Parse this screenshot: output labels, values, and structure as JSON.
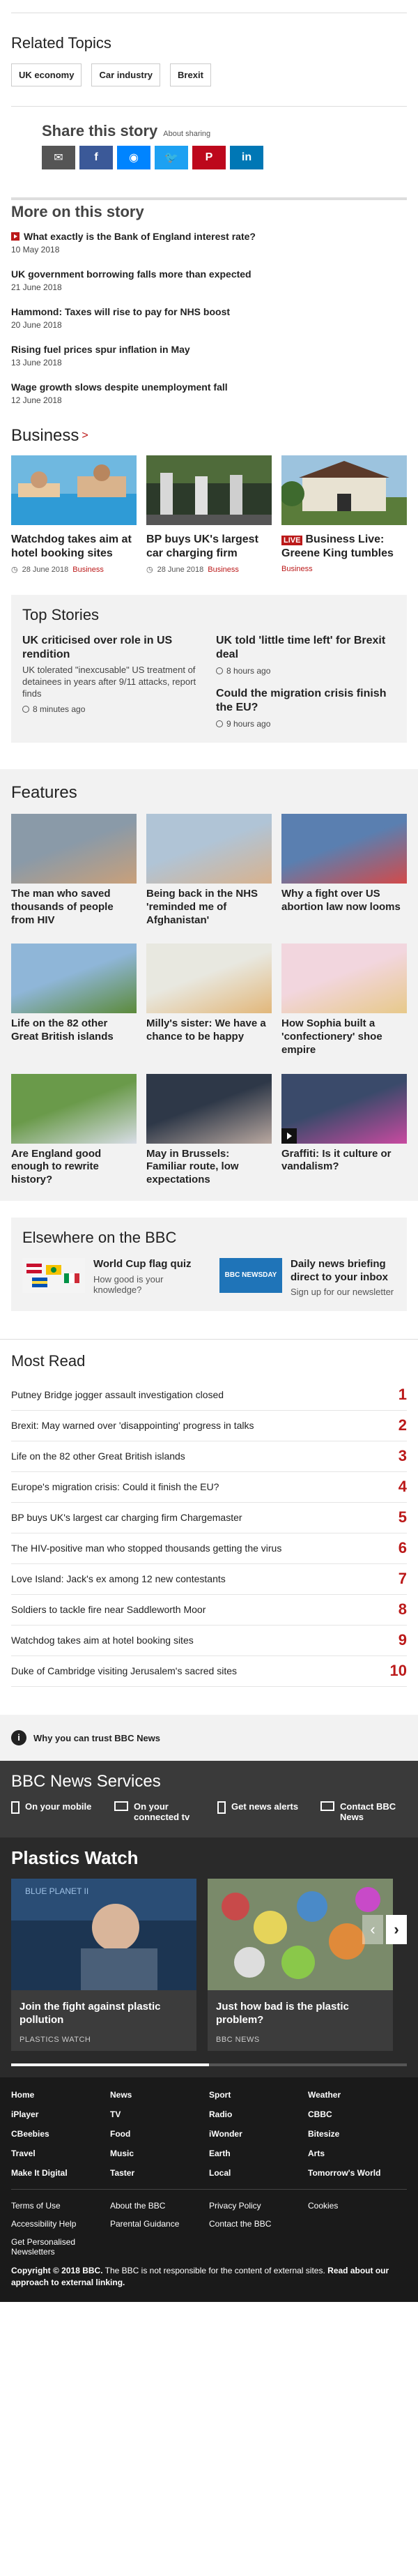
{
  "related": {
    "title": "Related Topics",
    "tags": [
      "UK economy",
      "Car industry",
      "Brexit"
    ]
  },
  "share": {
    "title": "Share this story",
    "about": "About sharing",
    "buttons": [
      {
        "name": "email-share-button",
        "glyph": "✉",
        "color": "#555555"
      },
      {
        "name": "facebook-share-button",
        "glyph": "f",
        "color": "#3b5998"
      },
      {
        "name": "messenger-share-button",
        "glyph": "◉",
        "color": "#0084ff"
      },
      {
        "name": "twitter-share-button",
        "glyph": "🐦",
        "color": "#1da1f2"
      },
      {
        "name": "pinterest-share-button",
        "glyph": "P",
        "color": "#bd081c"
      },
      {
        "name": "linkedin-share-button",
        "glyph": "in",
        "color": "#0077b5"
      }
    ]
  },
  "more": {
    "title": "More on this story",
    "stories": [
      {
        "title": "What exactly is the Bank of England interest rate?",
        "date": "10 May 2018",
        "video": true
      },
      {
        "title": "UK government borrowing falls more than expected",
        "date": "21 June 2018",
        "video": false
      },
      {
        "title": "Hammond: Taxes will rise to pay for NHS boost",
        "date": "20 June 2018",
        "video": false
      },
      {
        "title": "Rising fuel prices spur inflation in May",
        "date": "13 June 2018",
        "video": false
      },
      {
        "title": "Wage growth slows despite unemployment fall",
        "date": "12 June 2018",
        "video": false
      }
    ]
  },
  "business": {
    "title": "Business",
    "cards": [
      {
        "title": "Watchdog takes aim at hotel booking sites",
        "date": "28 June 2018",
        "source": "Business",
        "live": ""
      },
      {
        "title": "BP buys UK's largest car charging firm",
        "date": "28 June 2018",
        "source": "Business",
        "live": ""
      },
      {
        "title": "Business Live: Greene King tumbles",
        "date": "",
        "source": "Business",
        "live": "LIVE"
      }
    ]
  },
  "top": {
    "title": "Top Stories",
    "left": {
      "title": "UK criticised over role in US rendition",
      "summary": "UK tolerated \"inexcusable\" US treatment of detainees in years after 9/11 attacks, report finds",
      "time": "8 minutes ago"
    },
    "right": [
      {
        "title": "UK told 'little time left' for Brexit deal",
        "time": "8 hours ago"
      },
      {
        "title": "Could the migration crisis finish the EU?",
        "time": "9 hours ago"
      }
    ]
  },
  "features": {
    "title": "Features",
    "items": [
      {
        "title": "The man who saved thousands of people from HIV",
        "video": false
      },
      {
        "title": "Being back in the NHS 'reminded me of Afghanistan'",
        "video": false
      },
      {
        "title": "Why a fight over US abortion law now looms",
        "video": false
      },
      {
        "title": "Life on the 82 other Great British islands",
        "video": false
      },
      {
        "title": "Milly's sister: We have a chance to be happy",
        "video": false
      },
      {
        "title": "How Sophia built a 'confectionery' shoe empire",
        "video": false
      },
      {
        "title": "Are England good enough to rewrite history?",
        "video": false
      },
      {
        "title": "May in Brussels: Familiar route, low expectations",
        "video": false
      },
      {
        "title": "Graffiti: Is it culture or vandalism?",
        "video": true
      }
    ]
  },
  "elsewhere": {
    "title": "Elsewhere on the BBC",
    "items": [
      {
        "title": "World Cup flag quiz",
        "summary": "How good is your knowledge?"
      },
      {
        "title": "Daily news briefing direct to your inbox",
        "summary": "Sign up for our newsletter"
      }
    ],
    "logo_text": "BBC NEWSDAY"
  },
  "mostread": {
    "title": "Most Read",
    "items": [
      {
        "n": "1",
        "title": "Putney Bridge jogger assault investigation closed"
      },
      {
        "n": "2",
        "title": "Brexit: May warned over 'disappointing' progress in talks"
      },
      {
        "n": "3",
        "title": "Life on the 82 other Great British islands"
      },
      {
        "n": "4",
        "title": "Europe's migration crisis: Could it finish the EU?"
      },
      {
        "n": "5",
        "title": "BP buys UK's largest car charging firm Chargemaster"
      },
      {
        "n": "6",
        "title": "The HIV-positive man who stopped thousands getting the virus"
      },
      {
        "n": "7",
        "title": "Love Island: Jack's ex among 12 new contestants"
      },
      {
        "n": "8",
        "title": "Soldiers to tackle fire near Saddleworth Moor"
      },
      {
        "n": "9",
        "title": "Watchdog takes aim at hotel booking sites"
      },
      {
        "n": "10",
        "title": "Duke of Cambridge visiting Jerusalem's sacred sites"
      }
    ]
  },
  "trust": {
    "label": "Why you can trust BBC News",
    "icon": "i"
  },
  "services": {
    "title": "BBC News Services",
    "items": [
      "On your mobile",
      "On your connected tv",
      "Get news alerts",
      "Contact BBC News"
    ]
  },
  "plastics": {
    "title": "Plastics Watch",
    "cards": [
      {
        "title": "Join the fight against plastic pollution",
        "source": "PLASTICS WATCH"
      },
      {
        "title": "Just how bad is the plastic problem?",
        "source": "BBC NEWS"
      }
    ],
    "progress": 0.5
  },
  "footer": {
    "nav": [
      "Home",
      "News",
      "Sport",
      "Weather",
      "iPlayer",
      "TV",
      "Radio",
      "CBBC",
      "CBeebies",
      "Food",
      "iWonder",
      "Bitesize",
      "Travel",
      "Music",
      "Earth",
      "Arts",
      "Make It Digital",
      "Taster",
      "Local",
      "Tomorrow's World"
    ],
    "links": [
      "Terms of Use",
      "About the BBC",
      "Privacy Policy",
      "Cookies",
      "Accessibility Help",
      "Parental Guidance",
      "Contact the BBC",
      "",
      "Get Personalised Newsletters"
    ],
    "copyright_prefix": "Copyright © 2018 BBC.",
    "copyright_body": " The BBC is not responsible for the content of external sites.",
    "copyright_link": "Read about our approach to external linking."
  }
}
